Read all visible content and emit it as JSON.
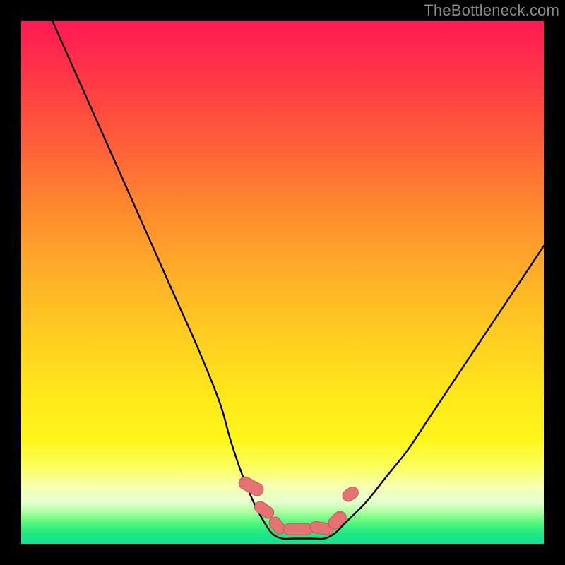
{
  "watermark": "TheBottleneck.com",
  "colors": {
    "frame": "#000000",
    "curve": "#000000",
    "marker_fill": "#e57373",
    "marker_stroke": "#c45555",
    "gradient_top": "#ff1a55",
    "gradient_bottom": "#14e291"
  },
  "chart_data": {
    "type": "line",
    "title": "",
    "xlabel": "",
    "ylabel": "",
    "xlim": [
      0,
      100
    ],
    "ylim": [
      0,
      100
    ],
    "note": "V-shaped bottleneck curve. x is normalized horizontal position (percent of plot width), y is percent from bottom (higher = more bottleneck / toward red).",
    "series": [
      {
        "name": "left-branch",
        "x": [
          6,
          10,
          14,
          18,
          22,
          26,
          30,
          34,
          38,
          40,
          42,
          44,
          46,
          48
        ],
        "y": [
          100,
          91,
          82,
          73,
          64,
          55,
          46,
          37,
          27,
          20,
          14,
          9,
          5,
          2
        ]
      },
      {
        "name": "valley",
        "x": [
          48,
          50,
          52,
          54,
          56,
          58,
          60,
          62
        ],
        "y": [
          2,
          1,
          1,
          1,
          1,
          1,
          2,
          4
        ]
      },
      {
        "name": "right-branch",
        "x": [
          62,
          66,
          70,
          74,
          78,
          82,
          86,
          90,
          94,
          98,
          100
        ],
        "y": [
          4,
          8,
          13,
          18,
          24,
          30,
          36,
          42,
          48,
          54,
          57
        ]
      }
    ],
    "markers": {
      "name": "pill-markers",
      "note": "Rounded pink capsule markers near the valley floor.",
      "points": [
        {
          "cx": 44.0,
          "cy": 11.0,
          "w": 2.4,
          "h": 5.0,
          "angle": -62
        },
        {
          "cx": 46.5,
          "cy": 6.5,
          "w": 2.2,
          "h": 4.0,
          "angle": -55
        },
        {
          "cx": 49.0,
          "cy": 3.5,
          "w": 2.2,
          "h": 3.6,
          "angle": -40
        },
        {
          "cx": 53.0,
          "cy": 2.8,
          "w": 5.5,
          "h": 2.2,
          "angle": 0
        },
        {
          "cx": 57.5,
          "cy": 3.0,
          "w": 4.5,
          "h": 2.2,
          "angle": 10
        },
        {
          "cx": 60.5,
          "cy": 4.5,
          "w": 2.4,
          "h": 3.8,
          "angle": 45
        },
        {
          "cx": 63.0,
          "cy": 9.5,
          "w": 2.2,
          "h": 3.2,
          "angle": 55
        }
      ]
    }
  }
}
